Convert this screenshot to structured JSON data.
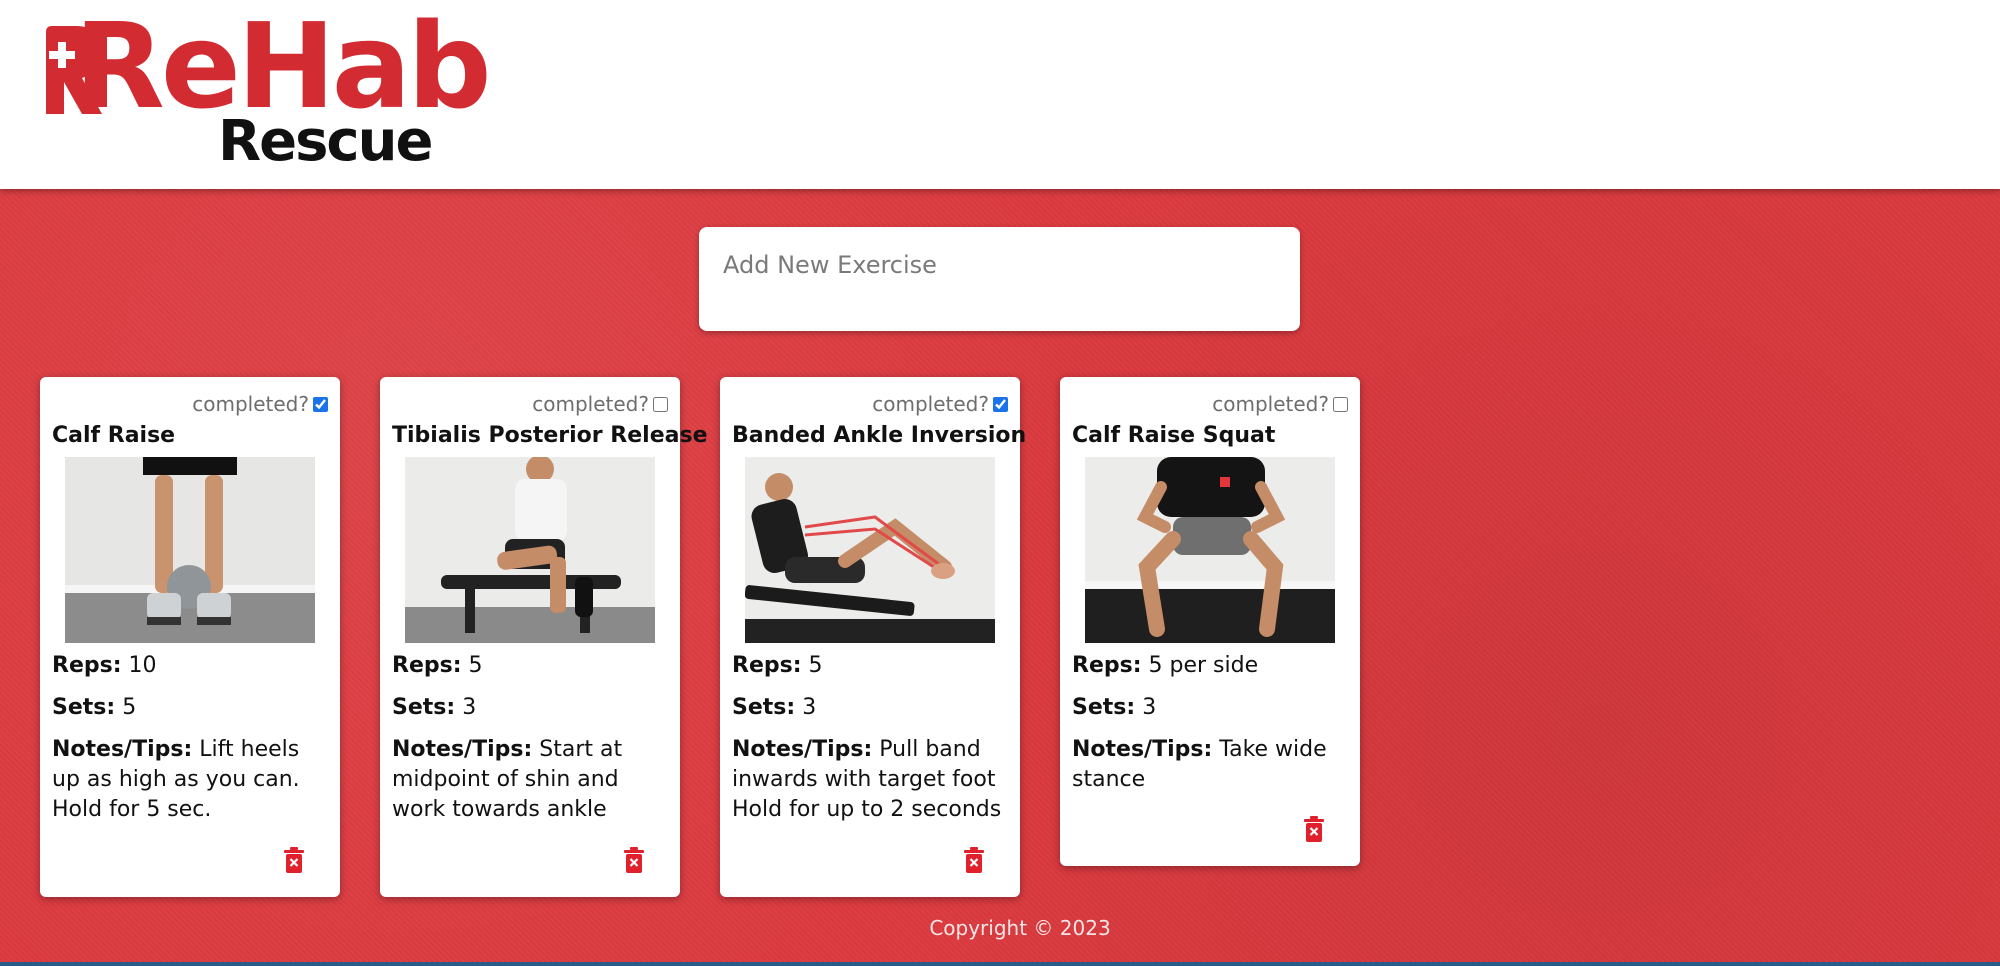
{
  "brand": {
    "name_top": "ReHab",
    "name_bottom": "Rescue",
    "accent": "#d32b32"
  },
  "add_exercise": {
    "placeholder": "Add New Exercise"
  },
  "cards": [
    {
      "completed_label": "completed?",
      "completed": true,
      "title": "Calf Raise",
      "reps_label": "Reps:",
      "reps": "10",
      "sets_label": "Sets:",
      "sets": "5",
      "notes_label": "Notes/Tips:",
      "notes_line1": "Lift heels up as high as you can.",
      "notes_line2": "Hold for 5 sec."
    },
    {
      "completed_label": "completed?",
      "completed": false,
      "title": "Tibialis Posterior Release",
      "reps_label": "Reps:",
      "reps": "5",
      "sets_label": "Sets:",
      "sets": "3",
      "notes_label": "Notes/Tips:",
      "notes_line1": "Start at midpoint of shin and work towards ankle",
      "notes_line2": ""
    },
    {
      "completed_label": "completed?",
      "completed": true,
      "title": "Banded Ankle Inversion",
      "reps_label": "Reps:",
      "reps": "5",
      "sets_label": "Sets:",
      "sets": "3",
      "notes_label": "Notes/Tips:",
      "notes_line1": "Pull band inwards with target foot",
      "notes_line2": "Hold for up to 2 seconds"
    },
    {
      "completed_label": "completed?",
      "completed": false,
      "title": "Calf Raise Squat",
      "reps_label": "Reps:",
      "reps": "5 per side",
      "sets_label": "Sets:",
      "sets": "3",
      "notes_label": "Notes/Tips:",
      "notes_line1": "Take wide stance",
      "notes_line2": ""
    }
  ],
  "footer": {
    "copyright": "Copyright © 2023"
  },
  "colors": {
    "background_red": "#dc3a3f",
    "checkbox_blue": "#1a73e8",
    "trash_red": "#e0202a"
  },
  "icons": {
    "delete": "trash-icon",
    "logo_mark": "medical-cross-icon"
  }
}
